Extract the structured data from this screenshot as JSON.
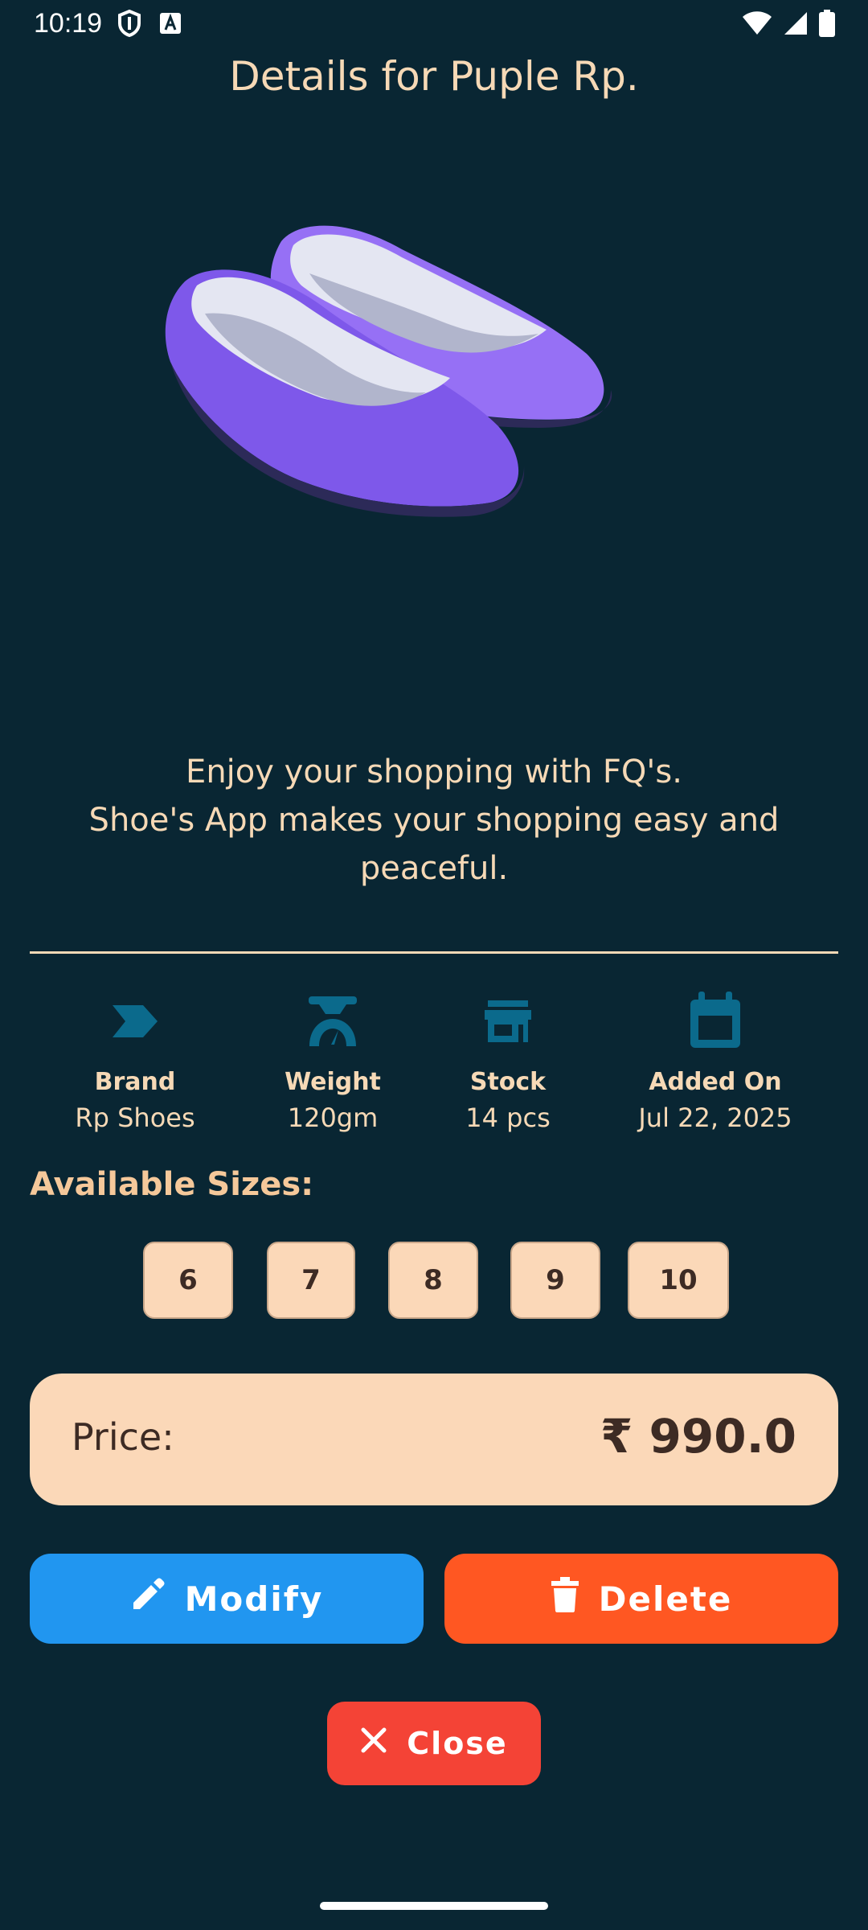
{
  "status_bar": {
    "time": "10:19",
    "icons": [
      "shield-icon",
      "keyboard-a-icon",
      "wifi-icon",
      "signal-icon",
      "battery-icon"
    ]
  },
  "page": {
    "title": "Details for Puple Rp."
  },
  "tagline": {
    "line1": "Enjoy your shopping with FQ's.",
    "line2": "Shoe's App makes your shopping easy and peaceful."
  },
  "info": [
    {
      "label": "Brand",
      "value": "Rp Shoes",
      "icon": "tag-icon"
    },
    {
      "label": "Weight",
      "value": "120gm",
      "icon": "scale-icon"
    },
    {
      "label": "Stock",
      "value": "14 pcs",
      "icon": "store-icon"
    },
    {
      "label": "Added On",
      "value": "Jul 22, 2025",
      "icon": "calendar-icon"
    }
  ],
  "sizes": {
    "title": "Available Sizes:",
    "values": [
      "6",
      "7",
      "8",
      "9",
      "10"
    ]
  },
  "price": {
    "label": "Price:",
    "value": "₹ 990.0"
  },
  "actions": {
    "modify_label": "Modify",
    "delete_label": "Delete",
    "close_label": "Close"
  },
  "colors": {
    "background": "#092633",
    "accent_text": "#f6d9b6",
    "icon_blue": "#0b6a8c",
    "modify": "#2196f0",
    "delete": "#ff5722",
    "close": "#f44336",
    "card": "#fbd8b8"
  }
}
